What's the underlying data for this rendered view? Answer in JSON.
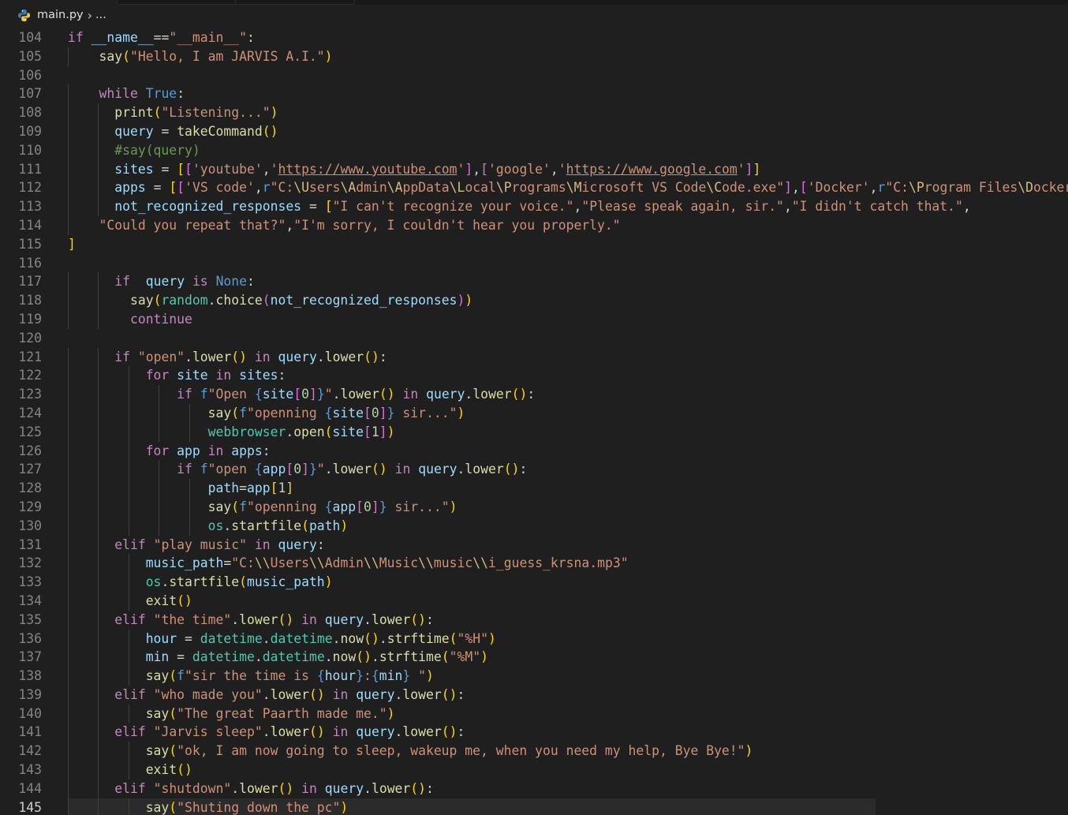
{
  "breadcrumb": {
    "file": "main.py",
    "separator": "›",
    "ellipsis": "..."
  },
  "editor": {
    "lines": [
      {
        "n": "104",
        "t": "if __name__==\"__main__\":"
      },
      {
        "n": "105",
        "t": "    say(\"Hello, I am JARVIS A.I.\")"
      },
      {
        "n": "106",
        "t": ""
      },
      {
        "n": "107",
        "t": "    while True:"
      },
      {
        "n": "108",
        "t": "      print(\"Listening...\")"
      },
      {
        "n": "109",
        "t": "      query = takeCommand()"
      },
      {
        "n": "110",
        "t": "      #say(query)"
      },
      {
        "n": "111",
        "t": "      sites = [['youtube','https://www.youtube.com'],['google','https://www.google.com']]"
      },
      {
        "n": "112",
        "t": "      apps = [['VS code',r\"C:\\Users\\Admin\\AppData\\Local\\Programs\\Microsoft VS Code\\Code.exe\"],['Docker',r\"C:\\Program Files\\Docker\\Do"
      },
      {
        "n": "113",
        "t": "      not_recognized_responses = [\"I can't recognize your voice.\",\"Please speak again, sir.\",\"I didn't catch that.\","
      },
      {
        "n": "114",
        "t": "    \"Could you repeat that?\",\"I'm sorry, I couldn't hear you properly.\""
      },
      {
        "n": "115",
        "t": "]"
      },
      {
        "n": "116",
        "t": ""
      },
      {
        "n": "117",
        "t": "      if  query is None:"
      },
      {
        "n": "118",
        "t": "        say(random.choice(not_recognized_responses))"
      },
      {
        "n": "119",
        "t": "        continue"
      },
      {
        "n": "120",
        "t": ""
      },
      {
        "n": "121",
        "t": "      if \"open\".lower() in query.lower():"
      },
      {
        "n": "122",
        "t": "          for site in sites:"
      },
      {
        "n": "123",
        "t": "              if f\"Open {site[0]}\".lower() in query.lower():"
      },
      {
        "n": "124",
        "t": "                  say(f\"openning {site[0]} sir...\")"
      },
      {
        "n": "125",
        "t": "                  webbrowser.open(site[1])"
      },
      {
        "n": "126",
        "t": "          for app in apps:"
      },
      {
        "n": "127",
        "t": "              if f\"open {app[0]}\".lower() in query.lower():"
      },
      {
        "n": "128",
        "t": "                  path=app[1]"
      },
      {
        "n": "129",
        "t": "                  say(f\"openning {app[0]} sir...\")"
      },
      {
        "n": "130",
        "t": "                  os.startfile(path)"
      },
      {
        "n": "131",
        "t": "      elif \"play music\" in query:"
      },
      {
        "n": "132",
        "t": "          music_path=\"C:\\\\Users\\\\Admin\\\\Music\\\\music\\\\i_guess_krsna.mp3\""
      },
      {
        "n": "133",
        "t": "          os.startfile(music_path)"
      },
      {
        "n": "134",
        "t": "          exit()"
      },
      {
        "n": "135",
        "t": "      elif \"the time\".lower() in query.lower():"
      },
      {
        "n": "136",
        "t": "          hour = datetime.datetime.now().strftime(\"%H\")"
      },
      {
        "n": "137",
        "t": "          min = datetime.datetime.now().strftime(\"%M\")"
      },
      {
        "n": "138",
        "t": "          say(f\"sir the time is {hour}:{min} \")"
      },
      {
        "n": "139",
        "t": "      elif \"who made you\".lower() in query.lower():"
      },
      {
        "n": "140",
        "t": "          say(\"The great Paarth made me.\")"
      },
      {
        "n": "141",
        "t": "      elif \"Jarvis sleep\".lower() in query.lower():"
      },
      {
        "n": "142",
        "t": "          say(\"ok, I am now going to sleep, wakeup me, when you need my help, Bye Bye!\")"
      },
      {
        "n": "143",
        "t": "          exit()"
      },
      {
        "n": "144",
        "t": "      elif \"shutdown\".lower() in query.lower():"
      },
      {
        "n": "145",
        "t": "          say(\"Shuting down the pc\")"
      }
    ]
  },
  "colors": {
    "background": "#1f1f1f",
    "keyword_control": "#c586c0",
    "keyword": "#569cd6",
    "string": "#ce9178",
    "function": "#dcdcaa",
    "variable": "#9cdcfe",
    "module": "#4ec9b0",
    "comment": "#6a9955",
    "line_number": "#858585"
  }
}
